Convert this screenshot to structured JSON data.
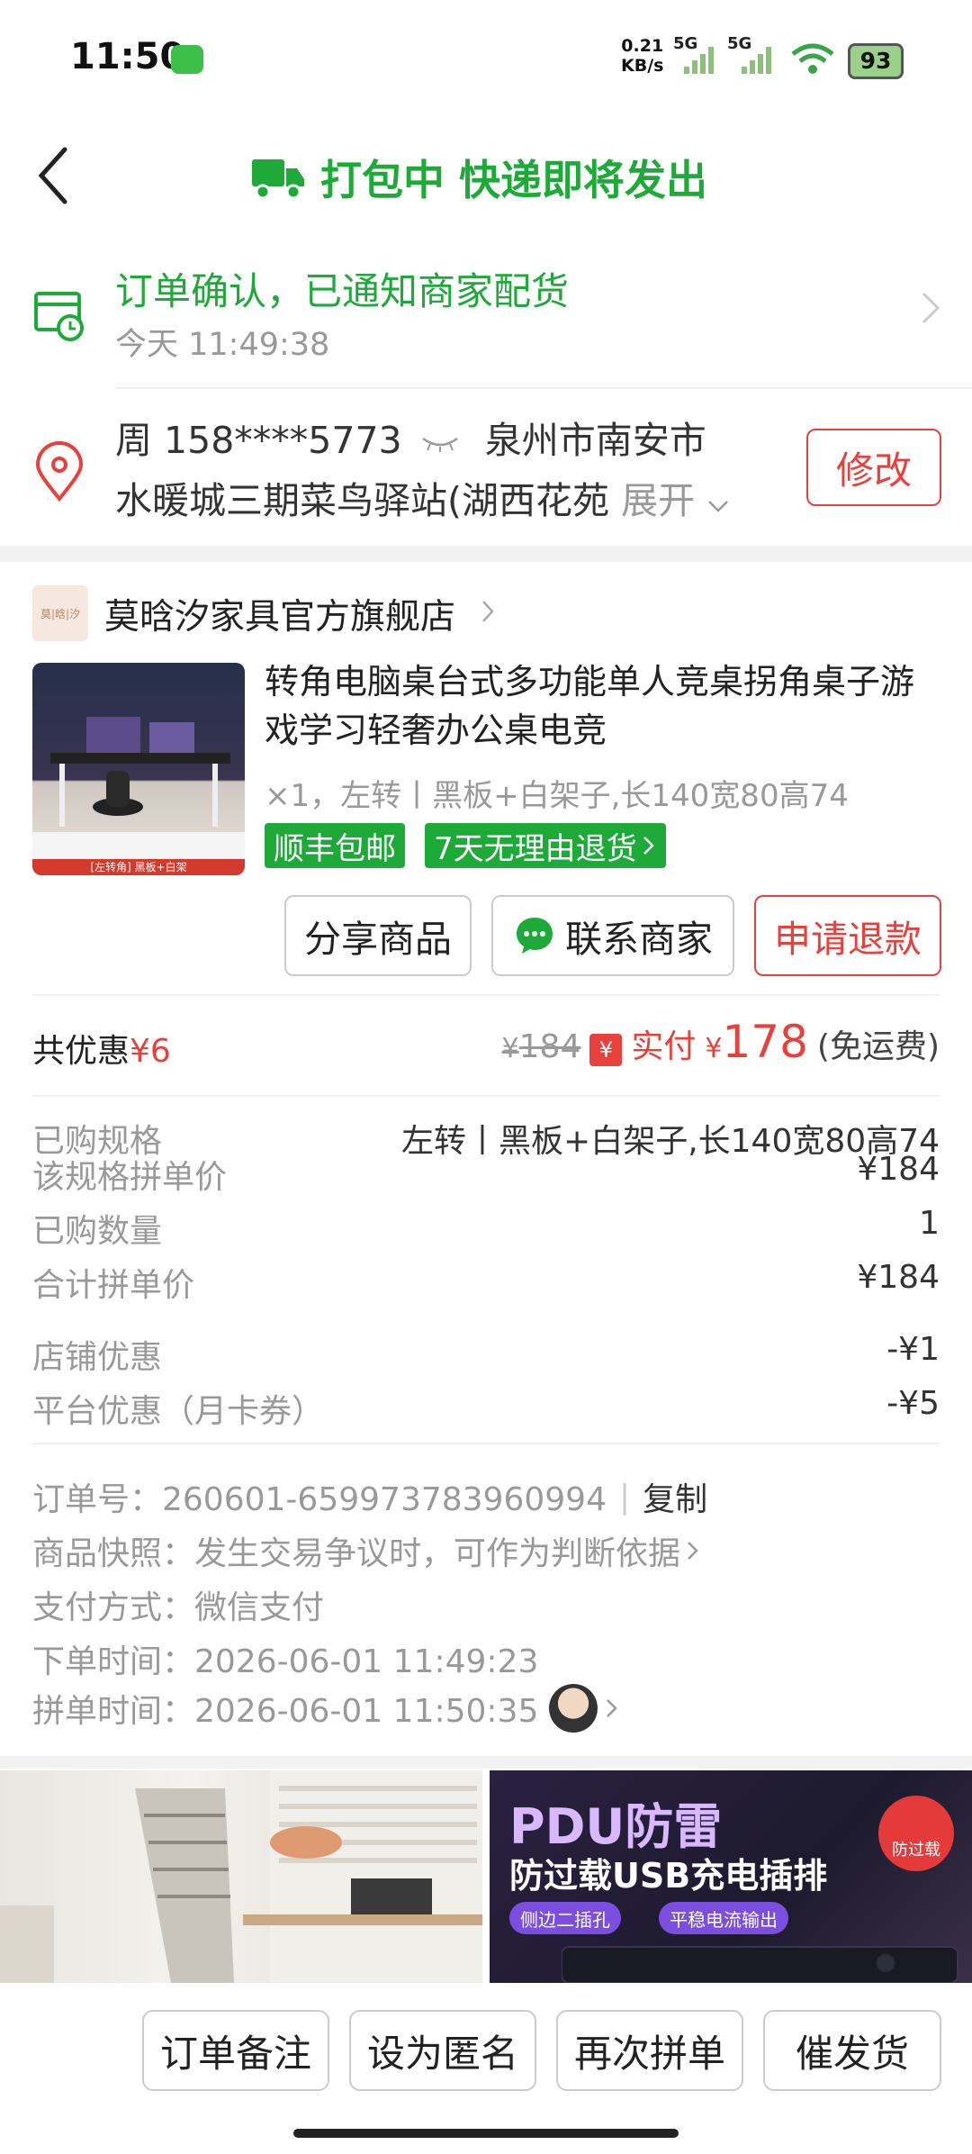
{
  "status_bar": {
    "time": "11:50",
    "net_speed_value": "0.21",
    "net_speed_unit": "KB/s",
    "net_type_1": "5G",
    "net_type_2": "5G",
    "battery": "93"
  },
  "header": {
    "title": "打包中 快递即将发出"
  },
  "order_status": {
    "text": "订单确认，已通知商家配货",
    "time": "今天 11:49:38"
  },
  "address": {
    "name_phone": "周 158****5773",
    "city": "泉州市南安市",
    "detail": "水暖城三期菜鸟驿站(湖西花苑",
    "expand_label": "展开",
    "modify_label": "修改"
  },
  "store": {
    "logo_text": "莫|晗|汐",
    "name": "莫晗汐家具官方旗舰店"
  },
  "product": {
    "title": "转角电脑桌台式多功能单人竞桌拐角桌子游戏学习轻奢办公桌电竞",
    "spec": "×1，左转丨黑板+白架子,长140宽80高74",
    "tags": [
      "顺丰包邮",
      "7天无理由退货"
    ],
    "image_caption": "[左转角] 黑板+白架"
  },
  "actions": {
    "share": "分享商品",
    "contact": "联系商家",
    "refund": "申请退款"
  },
  "price": {
    "discount_label": "共优惠",
    "discount_value": "¥6",
    "original": "184",
    "pay_badge": "¥",
    "pay_label": "实付",
    "currency": "¥",
    "pay_amount": "178",
    "shipping": "(免运费)"
  },
  "details": [
    {
      "label": "已购规格",
      "value": "左转丨黑板+白架子,长140宽80高74"
    },
    {
      "label": "该规格拼单价",
      "value": "¥184"
    },
    {
      "label": "已购数量",
      "value": "1"
    },
    {
      "label": "合计拼单价",
      "value": "¥184"
    },
    {
      "label": "店铺优惠",
      "value": "-¥1"
    },
    {
      "label": "平台优惠（月卡券）",
      "value": "-¥5"
    }
  ],
  "order_info": {
    "order_no": "订单号：260601-659973783960994",
    "copy_label": "复制",
    "snapshot": "商品快照：发生交易争议时，可作为判断依据",
    "payment": "支付方式：微信支付",
    "order_time": "下单时间：2026-06-01 11:49:23",
    "group_time": "拼单时间：2026-06-01 11:50:35"
  },
  "ads": {
    "ad2_title": "PDU防雷",
    "ad2_subtitle": "防过载USB充电插排",
    "ad2_chip1": "侧边二插孔",
    "ad2_chip2": "平稳电流输出",
    "ad2_badge": "防过载"
  },
  "bottom_bar": {
    "note": "订单备注",
    "anonymous": "设为匿名",
    "reorder": "再次拼单",
    "urge": "催发货"
  },
  "colors": {
    "green": "#1eaa39",
    "red": "#e8403a"
  }
}
